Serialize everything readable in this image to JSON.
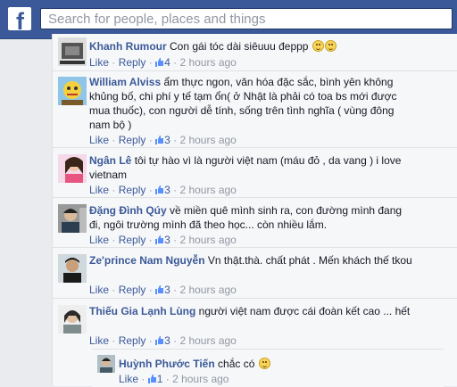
{
  "header": {
    "logo_letter": "f",
    "search_placeholder": "Search for people, places and things",
    "brand_color": "#3b5998"
  },
  "actions": {
    "like": "Like",
    "reply": "Reply",
    "separator": "·"
  },
  "comments": [
    {
      "name": "Khanh Rumour",
      "text": "Con gái tóc dài siêuuu đeppp",
      "emojis": [
        "slight-smile",
        "smile"
      ],
      "likes": "4",
      "time": "2 hours ago"
    },
    {
      "name": "William Alviss",
      "text": "ẩm thực ngon, văn hóa đặc sắc, bình yên không khủng bố, chi phí y tế tạm ổn( ở Nhật là phải có toa bs mới được mua thuốc), con người dễ tính, sống trên tình nghĩa ( vùng đông nam bộ )",
      "likes": "3",
      "time": "2 hours ago"
    },
    {
      "name": "Ngân Lê",
      "text": "tôi tự hào vì là người việt nam (máu đỏ , da vang ) i love vietnam",
      "likes": "3",
      "time": "2 hours ago"
    },
    {
      "name": "Đặng Đình Qúy",
      "text": "về miền quê mình sinh ra, con đường mình đang đi, ngôi trường mình đã theo học... còn nhiều lắm.",
      "likes": "3",
      "time": "2 hours ago"
    },
    {
      "name": "Ze'prince Nam Nguyễn",
      "text": "Vn thật.thà. chất phát . Mến khách thế tkou",
      "likes": "3",
      "time": "2 hours ago"
    },
    {
      "name": "Thiếu Gia Lạnh Lùng",
      "text": "người việt nam được cái đoàn kết cao ... hết",
      "likes": "3",
      "time": "2 hours ago"
    }
  ],
  "reply": {
    "name": "Huỳnh Phước Tiến",
    "text": "chắc có",
    "emojis": [
      "smile"
    ],
    "likes": "1",
    "time": "2 hours ago"
  }
}
